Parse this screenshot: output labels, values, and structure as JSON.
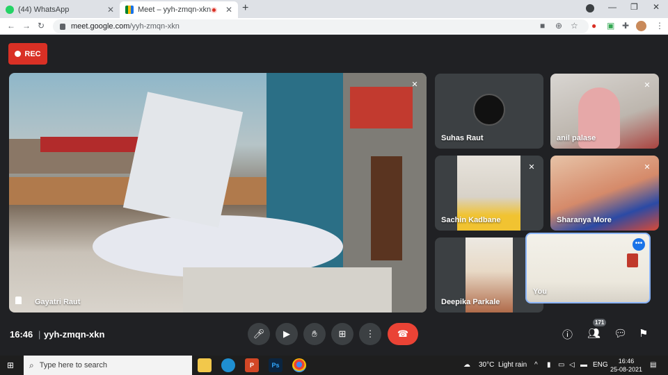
{
  "browser": {
    "tabs": [
      {
        "title": "(44) WhatsApp",
        "close": "✕"
      },
      {
        "title": "Meet – yyh-zmqn-xkn",
        "close": "✕"
      }
    ],
    "new_tab": "+",
    "window_controls": {
      "minimize": "—",
      "maximize": "❐",
      "close": "✕"
    },
    "address": {
      "host": "meet.google.com",
      "path": "/yyh-zmqn-xkn"
    },
    "profile_color": "#5f6368"
  },
  "meet": {
    "rec_label": "REC",
    "main_speaker": {
      "name": "Gayatri Raut"
    },
    "participants": [
      {
        "name": "Suhas Raut"
      },
      {
        "name": "anil palase"
      },
      {
        "name": "Sachin Kadbane"
      },
      {
        "name": "Sharanya More"
      },
      {
        "name": "Deepika Parkale"
      },
      {
        "name": "You"
      }
    ],
    "time": "16:46",
    "separator": "|",
    "meeting_code": "yyh-zmqn-xkn",
    "participant_count": "171",
    "colors": {
      "accent": "#1a73e8",
      "end_call": "#ea4335",
      "rec": "#d93025"
    }
  },
  "taskbar": {
    "search_placeholder": "Type here to search",
    "weather_temp": "30°C",
    "weather_desc": "Light rain",
    "language": "ENG",
    "clock_time": "16:46",
    "clock_date": "25-08-2021",
    "apps": [
      "file-explorer",
      "edge",
      "powerpoint",
      "photoshop",
      "chrome"
    ]
  }
}
